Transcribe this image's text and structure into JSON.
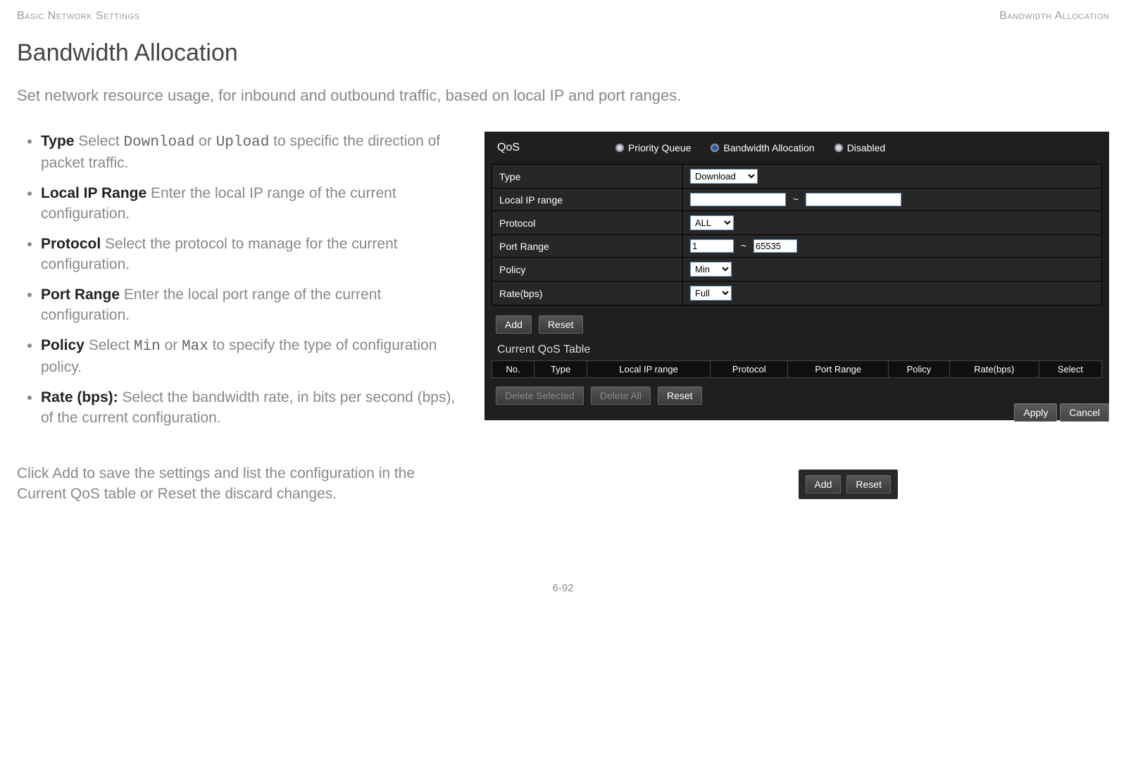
{
  "header": {
    "left": "Basic Network Settings",
    "right": "Bandwidth Allocation"
  },
  "title": "Bandwidth Allocation",
  "intro": "Set network resource usage, for inbound and outbound traffic, based on local IP and port ranges.",
  "bullets": [
    {
      "term": "Type",
      "code1": "Download",
      "mid": " or ",
      "code2": "Upload",
      "rest": " to specific the direction of packet traffic.",
      "lead": "  Select "
    },
    {
      "term": "Local IP Range",
      "lead": "  Enter the local IP range of the current configuration."
    },
    {
      "term": "Protocol",
      "lead": "  Select the protocol to manage for the current configuration."
    },
    {
      "term": "Port Range",
      "lead": "  Enter the local port range of the current configuration."
    },
    {
      "term": "Policy",
      "code1": "Min",
      "mid": " or ",
      "code2": "Max",
      "rest": " to specify the type of configuration policy.",
      "lead": "  Select "
    },
    {
      "term": "Rate (bps):",
      "lead": " Select the bandwidth rate, in bits per second (bps), of the current configuration."
    }
  ],
  "panel": {
    "qos_label": "QoS",
    "radios": [
      "Priority Queue",
      "Bandwidth Allocation",
      "Disabled"
    ],
    "selected_radio": 1,
    "rows": {
      "type": {
        "label": "Type",
        "value": "Download"
      },
      "ip": {
        "label": "Local IP range",
        "from": "",
        "to": ""
      },
      "proto": {
        "label": "Protocol",
        "value": "ALL"
      },
      "port": {
        "label": "Port Range",
        "from": "1",
        "to": "65535"
      },
      "policy": {
        "label": "Policy",
        "value": "Min"
      },
      "rate": {
        "label": "Rate(bps)",
        "value": "Full"
      }
    },
    "add": "Add",
    "reset": "Reset",
    "table_title": "Current QoS Table",
    "table_headers": [
      "No.",
      "Type",
      "Local IP range",
      "Protocol",
      "Port Range",
      "Policy",
      "Rate(bps)",
      "Select"
    ],
    "delete_selected": "Delete Selected",
    "delete_all": "Delete All",
    "reset2": "Reset",
    "apply": "Apply",
    "cancel": "Cancel"
  },
  "callout": {
    "pre": "Click ",
    "code1": "Add",
    "mid": " to save the settings and list the configuration in the Current QoS table or ",
    "code2": "Reset",
    "post": " the discard changes.",
    "btn_add": "Add",
    "btn_reset": "Reset"
  },
  "page_number": "6-92"
}
